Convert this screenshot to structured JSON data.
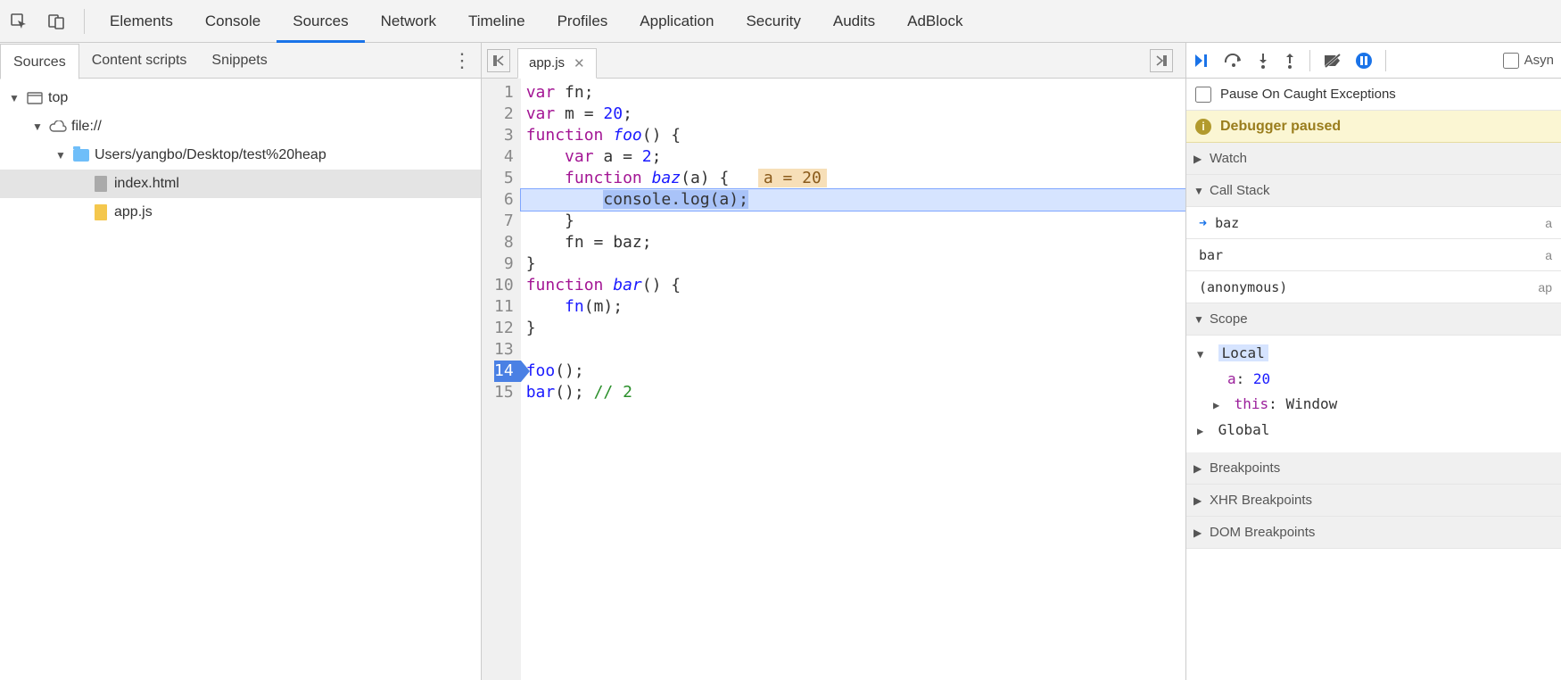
{
  "toolbar": {
    "tabs": [
      "Elements",
      "Console",
      "Sources",
      "Network",
      "Timeline",
      "Profiles",
      "Application",
      "Security",
      "Audits",
      "AdBlock"
    ],
    "active": 2
  },
  "left": {
    "sub_tabs": [
      "Sources",
      "Content scripts",
      "Snippets"
    ],
    "active": 0,
    "tree": {
      "root": "top",
      "scheme": "file://",
      "folder": "Users/yangbo/Desktop/test%20heap",
      "files": [
        "index.html",
        "app.js"
      ],
      "selected_file": "index.html"
    }
  },
  "center": {
    "file_tab": "app.js",
    "lines": [
      {
        "n": 1,
        "raw": "var fn;",
        "tokens": [
          [
            "kw",
            "var"
          ],
          [
            "",
            " fn;"
          ]
        ]
      },
      {
        "n": 2,
        "raw": "var m = 20;",
        "tokens": [
          [
            "kw",
            "var"
          ],
          [
            "",
            " m = "
          ],
          [
            "num",
            "20"
          ],
          [
            "",
            ";"
          ]
        ]
      },
      {
        "n": 3,
        "raw": "function foo() {",
        "tokens": [
          [
            "kw",
            "function"
          ],
          [
            "",
            " "
          ],
          [
            "fnname",
            "foo"
          ],
          [
            "",
            "() {"
          ]
        ]
      },
      {
        "n": 4,
        "raw": "    var a = 2;",
        "tokens": [
          [
            "",
            "    "
          ],
          [
            "kw",
            "var"
          ],
          [
            "",
            " a = "
          ],
          [
            "num",
            "2"
          ],
          [
            "",
            ";"
          ]
        ]
      },
      {
        "n": 5,
        "raw": "    function baz(a) {",
        "tokens": [
          [
            "",
            "    "
          ],
          [
            "kw",
            "function"
          ],
          [
            "",
            " "
          ],
          [
            "fnname",
            "baz"
          ],
          [
            "",
            "(a) {"
          ]
        ],
        "inline": "a = 20"
      },
      {
        "n": 6,
        "raw": "        console.log(a);",
        "exec": true,
        "tokens": [
          [
            "",
            "        "
          ],
          [
            "hl",
            "console.log(a);"
          ]
        ]
      },
      {
        "n": 7,
        "raw": "    }",
        "tokens": [
          [
            "",
            "    }"
          ]
        ]
      },
      {
        "n": 8,
        "raw": "    fn = baz;",
        "tokens": [
          [
            "",
            "    fn = baz;"
          ]
        ]
      },
      {
        "n": 9,
        "raw": "}",
        "tokens": [
          [
            "",
            "}"
          ]
        ]
      },
      {
        "n": 10,
        "raw": "function bar() {",
        "tokens": [
          [
            "kw",
            "function"
          ],
          [
            "",
            " "
          ],
          [
            "fnname",
            "bar"
          ],
          [
            "",
            "() {"
          ]
        ]
      },
      {
        "n": 11,
        "raw": "    fn(m);",
        "tokens": [
          [
            "",
            "    "
          ],
          [
            "call",
            "fn"
          ],
          [
            "",
            "(m);"
          ]
        ]
      },
      {
        "n": 12,
        "raw": "}",
        "tokens": [
          [
            "",
            "}"
          ]
        ]
      },
      {
        "n": 13,
        "raw": "",
        "tokens": [
          [
            "",
            " "
          ]
        ]
      },
      {
        "n": 14,
        "raw": "foo();",
        "bp": true,
        "tokens": [
          [
            "call",
            "foo"
          ],
          [
            "",
            "();"
          ]
        ]
      },
      {
        "n": 15,
        "raw": "bar(); // 2",
        "tokens": [
          [
            "call",
            "bar"
          ],
          [
            "",
            "(); "
          ],
          [
            "comment",
            "// 2"
          ]
        ]
      }
    ]
  },
  "right": {
    "async_label": "Asyn",
    "pause_caught": "Pause On Caught Exceptions",
    "banner": "Debugger paused",
    "sections": {
      "watch": "Watch",
      "callstack": "Call Stack",
      "scope": "Scope",
      "breakpoints": "Breakpoints",
      "xhr": "XHR Breakpoints",
      "dom": "DOM Breakpoints"
    },
    "callstack": [
      {
        "name": "baz",
        "src": "a",
        "current": true
      },
      {
        "name": "bar",
        "src": "a"
      },
      {
        "name": "(anonymous)",
        "src": "ap"
      }
    ],
    "scope": {
      "local_label": "Local",
      "vars": [
        {
          "name": "a",
          "value": "20"
        }
      ],
      "this_label": "this",
      "this_value": "Window",
      "global_label": "Global"
    }
  }
}
